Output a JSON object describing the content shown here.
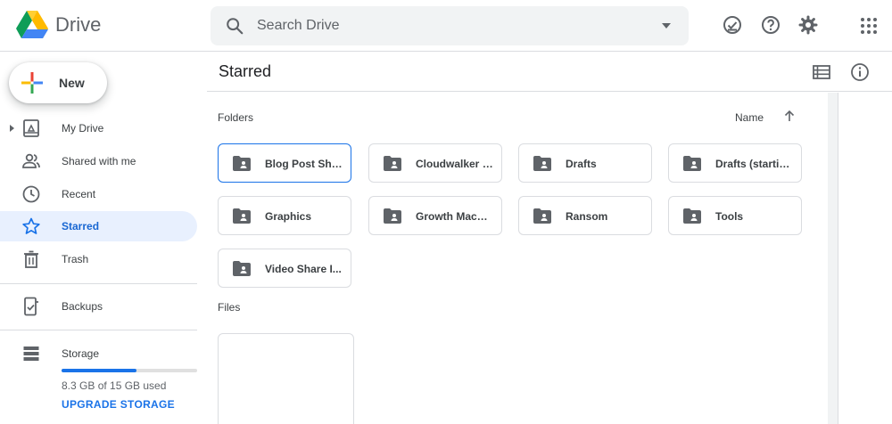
{
  "header": {
    "brand": "Drive",
    "search_placeholder": "Search Drive",
    "icons": [
      "offline-check-icon",
      "help-icon",
      "settings-gear-icon",
      "apps-grid-icon"
    ]
  },
  "sidebar": {
    "new_label": "New",
    "items": [
      {
        "label": "My Drive",
        "icon": "my-drive-icon",
        "active": false
      },
      {
        "label": "Shared with me",
        "icon": "shared-people-icon",
        "active": false
      },
      {
        "label": "Recent",
        "icon": "clock-icon",
        "active": false
      },
      {
        "label": "Starred",
        "icon": "star-icon",
        "active": true
      },
      {
        "label": "Trash",
        "icon": "trash-icon",
        "active": false
      },
      {
        "label": "Backups",
        "icon": "backup-phone-icon",
        "active": false
      },
      {
        "label": "Storage",
        "icon": "storage-icon",
        "active": false
      }
    ],
    "storage": {
      "used_text": "8.3 GB of 15 GB used",
      "used_fraction": 0.553,
      "upgrade_label": "UPGRADE STORAGE"
    }
  },
  "main": {
    "title": "Starred",
    "folders_label": "Folders",
    "sort_label": "Name",
    "files_label": "Files",
    "folders": [
      {
        "name": "Blog Post Sha...",
        "selected": true
      },
      {
        "name": "Cloudwalker s...",
        "selected": false
      },
      {
        "name": "Drafts",
        "selected": false
      },
      {
        "name": "Drafts (startin...",
        "selected": false
      },
      {
        "name": "Graphics",
        "selected": false
      },
      {
        "name": "Growth Machi...",
        "selected": false
      },
      {
        "name": "Ransom",
        "selected": false
      },
      {
        "name": "Tools",
        "selected": false
      },
      {
        "name": "Video Share I...",
        "selected": false
      }
    ]
  },
  "colors": {
    "accent": "#1a73e8",
    "active_bg": "#e8f0fe",
    "border": "#dadce0",
    "icon_gray": "#5f6368"
  }
}
